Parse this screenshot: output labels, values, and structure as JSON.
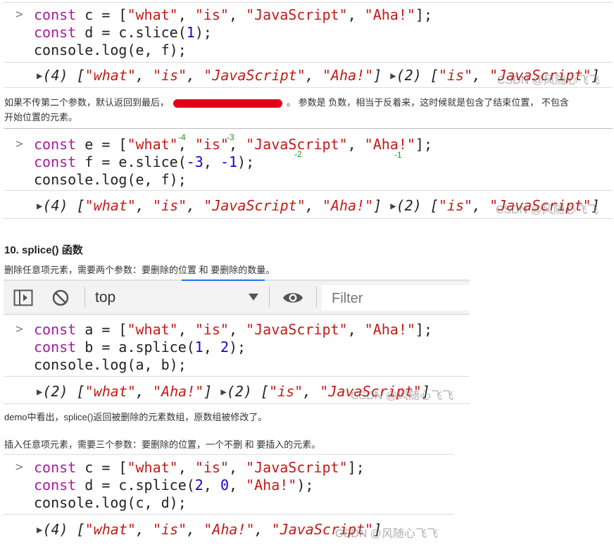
{
  "colors": {
    "keyword": "#a61d9c",
    "string": "#c41a16",
    "number": "#1c00cf",
    "annotation": "#1a9a1a",
    "redaction": "#e3001b"
  },
  "block1": {
    "line1": {
      "kw": "const",
      "name": " c = [",
      "s1": "\"what\"",
      "c1": ", ",
      "s2": "\"is\"",
      "c2": ", ",
      "s3": "\"JavaScript\"",
      "c3": ", ",
      "s4": "\"Aha!\"",
      "end": "];"
    },
    "line2": {
      "kw": "const",
      "pre": " d = c.slice(",
      "n1": "1",
      "end": ");"
    },
    "line3": "console.log(e, f);",
    "output": {
      "r1": "(4) [",
      "s1": "\"what\"",
      "c1": ", ",
      "s2": "\"is\"",
      "c2": ", ",
      "s3": "\"JavaScript\"",
      "c3": ", ",
      "s4": "\"Aha!\"",
      "e1": "]",
      "r2": "(2) [",
      "s5": "\"is\"",
      "c4": ", ",
      "s6": "\"JavaScript\"",
      "e2": "]"
    }
  },
  "para1": {
    "text_a": "如果不传第二个参数，默认返回到最后，",
    "text_b": "。 参数是 负数，相当于反着来，这时候就是包含了结束位置， 不包含",
    "text_c": "开始位置的元素。"
  },
  "block2": {
    "line1": {
      "kw": "const",
      "name": " e = [",
      "s1": "\"what\"",
      "c1": ", ",
      "s2": "\"is\"",
      "c2": ", ",
      "s3": "\"JavaScript\"",
      "c3": ", ",
      "s4": "\"Aha!\"",
      "end": "];"
    },
    "line2": {
      "kw": "const",
      "pre": " f = e.slice(",
      "n1": "-3",
      "c1": ", ",
      "n2": "-1",
      "end": ");"
    },
    "line3": "console.log(e, f);",
    "annotations": {
      "a1": "-4",
      "a2": "-3",
      "a3": "-2",
      "a4": "-1"
    },
    "output": {
      "r1": "(4) [",
      "s1": "\"what\"",
      "c1": ", ",
      "s2": "\"is\"",
      "c2": ", ",
      "s3": "\"JavaScript\"",
      "c3": ", ",
      "s4": "\"Aha!\"",
      "e1": "]",
      "r2": "(2) [",
      "s5": "\"is\"",
      "c4": ", ",
      "s6": "\"JavaScript\"",
      "e2": "]"
    }
  },
  "heading2": "10. splice() 函数",
  "para2": "删除任意项元素，需要两个参数：要删除的位置 和 要删除的数量。",
  "toolbar": {
    "context": "top",
    "filter_placeholder": "Filter"
  },
  "block3": {
    "line1": {
      "kw": "const",
      "name": " a = [",
      "s1": "\"what\"",
      "c1": ", ",
      "s2": "\"is\"",
      "c2": ", ",
      "s3": "\"JavaScript\"",
      "c3": ", ",
      "s4": "\"Aha!\"",
      "end": "];"
    },
    "line2": {
      "kw": "const",
      "pre": " b = a.splice(",
      "n1": "1",
      "c1": ", ",
      "n2": "2",
      "end": ");"
    },
    "line3": "console.log(a, b);",
    "output": {
      "r1": "(2) [",
      "s1": "\"what\"",
      "c1": ", ",
      "s2": "\"Aha!\"",
      "e1": "]",
      "r2": "(2) [",
      "s3": "\"is\"",
      "c2": ", ",
      "s4": "\"JavaScript\"",
      "e2": "]"
    }
  },
  "para3": "demo中看出，splice()返回被删除的元素数组，原数组被修改了。",
  "para4": "插入任意项元素，需要三个参数：要删除的位置，一个不删 和 要插入的元素。",
  "block4": {
    "line1": {
      "kw": "const",
      "name": " c = [",
      "s1": "\"what\"",
      "c1": ", ",
      "s2": "\"is\"",
      "c2": ", ",
      "s3": "\"JavaScript\"",
      "end": "];"
    },
    "line2": {
      "kw": "const",
      "pre": " d = c.splice(",
      "n1": "2",
      "c1": ", ",
      "n2": "0",
      "c2": ", ",
      "s1": "\"Aha!\"",
      "end": ");"
    },
    "line3": "console.log(c, d);",
    "output": {
      "r1": "(4) [",
      "s1": "\"what\"",
      "c1": ", ",
      "s2": "\"is\"",
      "c2": ", ",
      "s3": "\"Aha!\"",
      "c3": ", ",
      "s4": "\"JavaScript\"",
      "e1": "]"
    }
  },
  "watermark": "CSDN @风随心飞飞"
}
